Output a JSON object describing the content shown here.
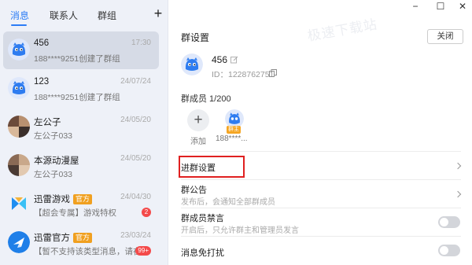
{
  "tabs": [
    {
      "label": "消息",
      "active": true
    },
    {
      "label": "联系人",
      "active": false
    },
    {
      "label": "群组",
      "active": false
    }
  ],
  "add_button": "+",
  "conversations": [
    {
      "name": "456",
      "subtitle": "188****9251创建了群组",
      "time": "17:30",
      "avatar": "blue-mascot",
      "selected": true
    },
    {
      "name": "123",
      "subtitle": "188****9251创建了群组",
      "time": "24/07/24",
      "avatar": "blue-mascot"
    },
    {
      "name": "左公子",
      "subtitle": "左公子033",
      "time": "24/05/20",
      "avatar": "photo-mosaic"
    },
    {
      "name": "本源动漫屋",
      "subtitle": "左公子033",
      "time": "24/05/20",
      "avatar": "photo-mosaic"
    },
    {
      "name": "迅雷游戏",
      "badge": "官方",
      "subtitle": "【超会专属】游戏特权",
      "time": "24/04/30",
      "unread": "2",
      "avatar": "xunlei-logo"
    },
    {
      "name": "迅雷官方",
      "badge": "官方",
      "subtitle": "【暂不支持该类型消息，请在手...",
      "time": "23/03/24",
      "unread": "99+",
      "avatar": "bird-logo"
    }
  ],
  "window": {
    "minimize": "−",
    "maximize": "☐",
    "close": "✕"
  },
  "watermark": "极速下载站",
  "settings": {
    "title": "群设置",
    "close_label": "关闭",
    "group_name": "456",
    "group_id": "ID：1228762751",
    "members_title": "群成员 1/200",
    "add_label": "添加",
    "member_label": "188****...",
    "owner_badge": "群主",
    "rows": {
      "join_settings": {
        "title": "进群设置"
      },
      "announcement": {
        "title": "群公告",
        "subtitle": "发布后，会通知全部群成员"
      },
      "mute_all": {
        "title": "群成员禁言",
        "subtitle": "开启后，只允许群主和管理员发言",
        "on": false
      },
      "do_not_disturb": {
        "title": "消息免打扰",
        "on": false
      }
    }
  },
  "colors": {
    "accent": "#2b7cf6",
    "highlight": "#e02020",
    "official_badge": "#f0a020",
    "unread": "#f44a4a"
  }
}
